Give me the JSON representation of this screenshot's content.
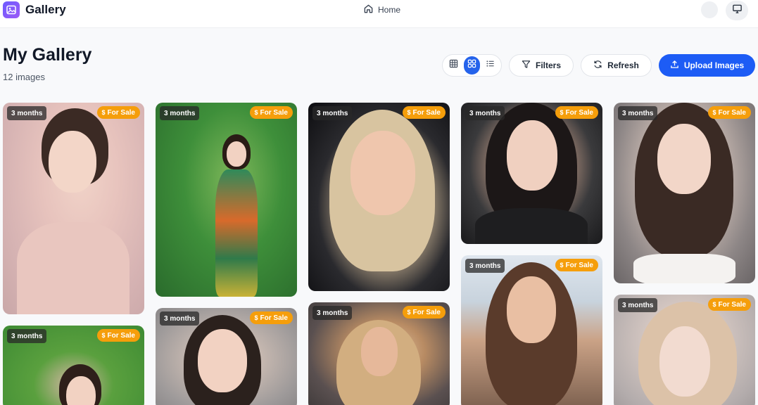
{
  "header": {
    "app_title": "Gallery",
    "nav_home_label": "Home"
  },
  "page": {
    "title": "My Gallery",
    "count": "12 images"
  },
  "toolbar": {
    "filters_label": "Filters",
    "refresh_label": "Refresh",
    "upload_label": "Upload Images",
    "view_modes": [
      "grid",
      "masonry",
      "list"
    ],
    "active_view": "masonry"
  },
  "badges": {
    "age": "3 months",
    "sale": "For Sale"
  },
  "colors": {
    "accent": "#1d5cf5",
    "sale_badge": "#f59e0b",
    "logo_gradient_start": "#6d5cff",
    "logo_gradient_end": "#9b59f6"
  },
  "cards": [
    {
      "age": "3 months",
      "sale": "For Sale"
    },
    {
      "age": "3 months",
      "sale": "For Sale"
    },
    {
      "age": "3 months",
      "sale": "For Sale"
    },
    {
      "age": "3 months",
      "sale": "For Sale"
    },
    {
      "age": "3 months",
      "sale": "For Sale"
    },
    {
      "age": "3 months",
      "sale": "For Sale"
    },
    {
      "age": "3 months",
      "sale": "For Sale"
    },
    {
      "age": "3 months",
      "sale": "For Sale"
    },
    {
      "age": "3 months",
      "sale": "For Sale"
    },
    {
      "age": "3 months",
      "sale": "For Sale"
    }
  ]
}
